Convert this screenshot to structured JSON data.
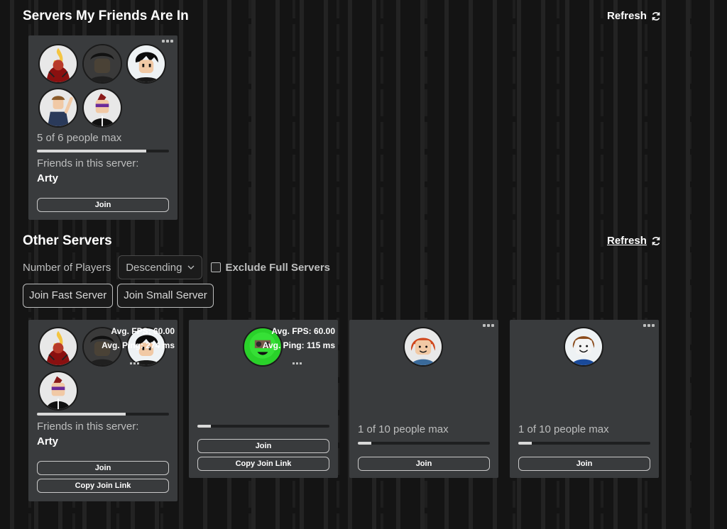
{
  "friends_section": {
    "title": "Servers My Friends Are In",
    "refresh_label": "Refresh",
    "card": {
      "players_text": "5 of 6 people max",
      "fill_fraction": 0.83,
      "friends_label": "Friends in this server:",
      "friend_name": "Arty",
      "join_label": "Join"
    }
  },
  "other_section": {
    "title": "Other Servers",
    "refresh_label": "Refresh",
    "sort_label": "Number of Players",
    "sort_value": "Descending",
    "exclude_label": "Exclude Full Servers",
    "join_fast_label": "Join Fast Server",
    "join_small_label": "Join Small Server"
  },
  "servers": [
    {
      "fps": "Avg. FPS: 60.00",
      "ping": "Avg. Ping: 274 ms",
      "fill_fraction": 0.67,
      "friends_label": "Friends in this server:",
      "friend_name": "Arty",
      "join_label": "Join",
      "copy_label": "Copy Join Link"
    },
    {
      "fps": "Avg. FPS: 60.00",
      "ping": "Avg. Ping: 115 ms",
      "fill_fraction": 0.1,
      "join_label": "Join",
      "copy_label": "Copy Join Link"
    },
    {
      "players_text": "1 of 10 people max",
      "fill_fraction": 0.1,
      "join_label": "Join"
    },
    {
      "players_text": "1 of 10 people max",
      "fill_fraction": 0.1,
      "join_label": "Join"
    }
  ],
  "colors": {
    "card_bg": "#393b3d",
    "bar_fill": "#d9d9d9",
    "muted_text": "#bdbebe"
  }
}
